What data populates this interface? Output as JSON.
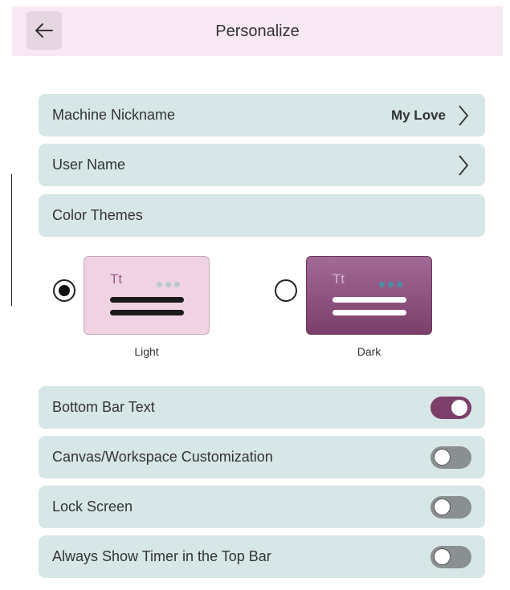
{
  "header": {
    "title": "Personalize",
    "back_icon": "arrow-left-icon"
  },
  "settings": {
    "machine_nickname": {
      "label": "Machine Nickname",
      "value": "My Love"
    },
    "user_name": {
      "label": "User Name"
    },
    "color_themes": {
      "label": "Color Themes"
    }
  },
  "themes": {
    "light": {
      "label": "Light",
      "sample": "Tt",
      "selected": true
    },
    "dark": {
      "label": "Dark",
      "sample": "Tt",
      "selected": false
    }
  },
  "toggles": {
    "bottom_bar_text": {
      "label": "Bottom Bar Text",
      "on": true
    },
    "canvas_customization": {
      "label": "Canvas/Workspace Customization",
      "on": false
    },
    "lock_screen": {
      "label": "Lock Screen",
      "on": false
    },
    "timer_top_bar": {
      "label": "Always Show Timer in the Top Bar",
      "on": false
    }
  },
  "colors": {
    "header_bg": "#f8e8f4",
    "row_bg": "#d7e6e6",
    "accent": "#7b3f6a"
  }
}
